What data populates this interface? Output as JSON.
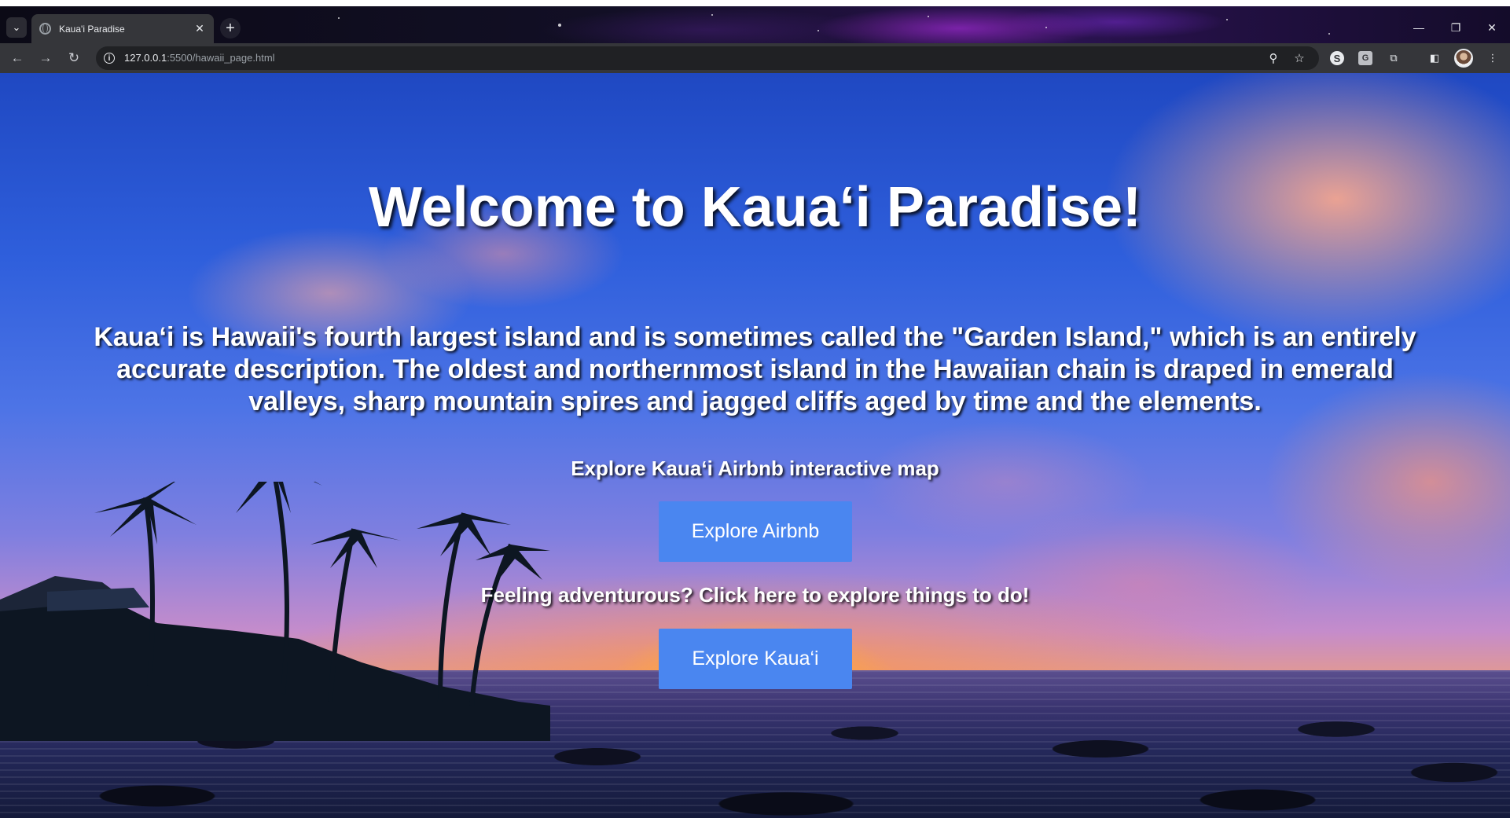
{
  "browser": {
    "tab_title": "Kaua'i Paradise",
    "url_host": "127.0.0.1",
    "url_path": ":5500/hawaii_page.html",
    "icons": {
      "tab_search": "chevron-down-icon",
      "favicon": "globe-icon",
      "tab_close": "close-icon",
      "new_tab": "plus-icon",
      "back": "arrow-left-icon",
      "forward": "arrow-right-icon",
      "reload": "reload-icon",
      "site_info": "info-icon",
      "zoom": "magnifier-icon",
      "bookmark": "star-icon",
      "extension_1": "s-extension-icon",
      "extension_2": "grammar-extension-icon",
      "extensions": "puzzle-icon",
      "side_panel": "side-panel-icon",
      "menu": "kebab-menu-icon"
    },
    "glyphs": {
      "chevron": "⌄",
      "close": "✕",
      "plus": "+",
      "back": "←",
      "forward": "→",
      "reload": "↻",
      "info": "i",
      "zoom": "⚲",
      "star": "☆",
      "ext_s": "S",
      "ext_g": "G",
      "puzzle": "⧉",
      "side_panel": "◧",
      "menu": "⋮",
      "minimize": "—",
      "restore": "❐",
      "window_close": "✕"
    }
  },
  "page": {
    "heading": "Welcome to Kaua‘i Paradise!",
    "intro": "Kaua‘i is Hawaii's fourth largest island and is sometimes called the \"Garden Island,\" which is an entirely accurate description. The oldest and northernmost island in the Hawaiian chain is draped in emerald valleys, sharp mountain spires and jagged cliffs aged by time and the elements.",
    "airbnb_prompt": "Explore Kaua‘i Airbnb interactive map",
    "airbnb_button": "Explore Airbnb",
    "adventure_prompt": "Feeling adventurous? Click here to explore things to do!",
    "adventure_button": "Explore Kaua‘i"
  },
  "colors": {
    "button_bg": "#4a86f0",
    "text": "#ffffff"
  }
}
